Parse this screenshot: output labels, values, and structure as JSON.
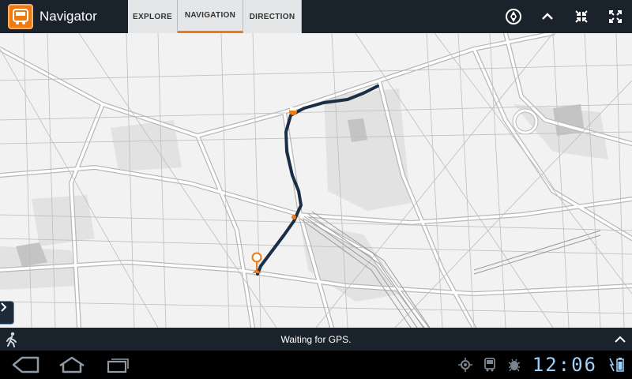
{
  "app": {
    "title": "Navigator",
    "logo_icon": "bus-icon",
    "accent_color": "#f07a10"
  },
  "tabs": [
    {
      "label": "EXPLORE",
      "selected": false
    },
    {
      "label": "NAVIGATION",
      "selected": true
    },
    {
      "label": "DIRECTION",
      "selected": false
    }
  ],
  "toolbar_icons": [
    "compass-icon",
    "chevron-up-icon",
    "collapse-icon",
    "expand-icon"
  ],
  "map": {
    "route_color": "#1c2e45",
    "marker_color": "#f07a10"
  },
  "status": {
    "message": "Waiting for GPS.",
    "mode_icon": "walk-icon"
  },
  "system_bar": {
    "clock": "12:06",
    "tray_icons": [
      "gps-icon",
      "bus-icon",
      "usb-debug-icon",
      "battery-icon"
    ]
  }
}
